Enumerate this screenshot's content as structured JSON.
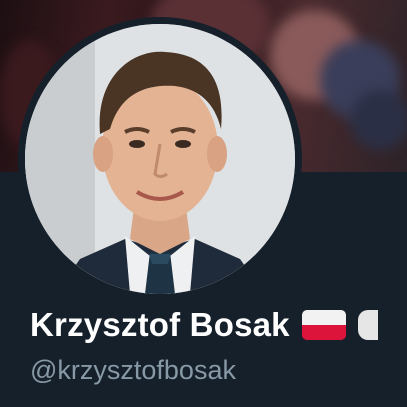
{
  "profile": {
    "display_name": "Krzysztof Bosak",
    "handle": "@krzysztofbosak",
    "name_emojis": [
      "poland-flag-icon",
      "partial-emoji-icon"
    ]
  },
  "colors": {
    "background": "#15202b",
    "name_text": "#ffffff",
    "handle_text": "#8899a6",
    "flag_white": "#f2f2f2",
    "flag_red": "#dc143c"
  }
}
